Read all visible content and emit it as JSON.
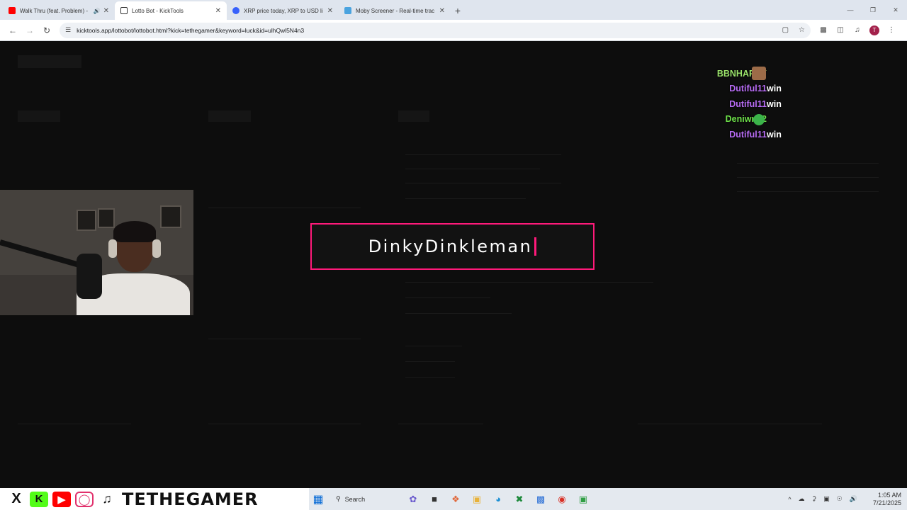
{
  "browser": {
    "tabs": [
      {
        "title": "Walk Thru (feat. Problem) -",
        "favicon_color": "#ff0000",
        "muted": true,
        "active": false
      },
      {
        "title": "Lotto Bot - KickTools",
        "favicon_color": "#333333",
        "muted": false,
        "active": true
      },
      {
        "title": "XRP price today, XRP to USD li",
        "favicon_color": "#3861fb",
        "muted": false,
        "active": false
      },
      {
        "title": "Moby Screener - Real-time trac",
        "favicon_color": "#4aa3df",
        "muted": false,
        "active": false
      }
    ],
    "url": "kicktools.app/lottobot/lottobot.html?kick=tethegamer&keyword=luck&id=ulhQwl5N4n3",
    "profile_initial": "T"
  },
  "chat": [
    {
      "user": "BBNHAPPY",
      "color": "#9be36b",
      "message": "",
      "emote": "face-emote"
    },
    {
      "user": "Dutiful11",
      "color": "#b86cf5",
      "message": "win",
      "emote": ""
    },
    {
      "user": "Dutiful11",
      "color": "#b86cf5",
      "message": "win",
      "emote": ""
    },
    {
      "user": "Deniwn22",
      "color": "#6ee24a",
      "message": "",
      "emote": "green-emote"
    },
    {
      "user": "Dutiful11",
      "color": "#b86cf5",
      "message": "win",
      "emote": ""
    }
  ],
  "winner": {
    "name": "DinkyDinkleman",
    "accent": "#ff1a7a"
  },
  "brand": {
    "handle": "TETHEGAMER"
  },
  "taskbar": {
    "search_label": "Search",
    "time": "1:05 AM",
    "date": "7/21/2025"
  }
}
